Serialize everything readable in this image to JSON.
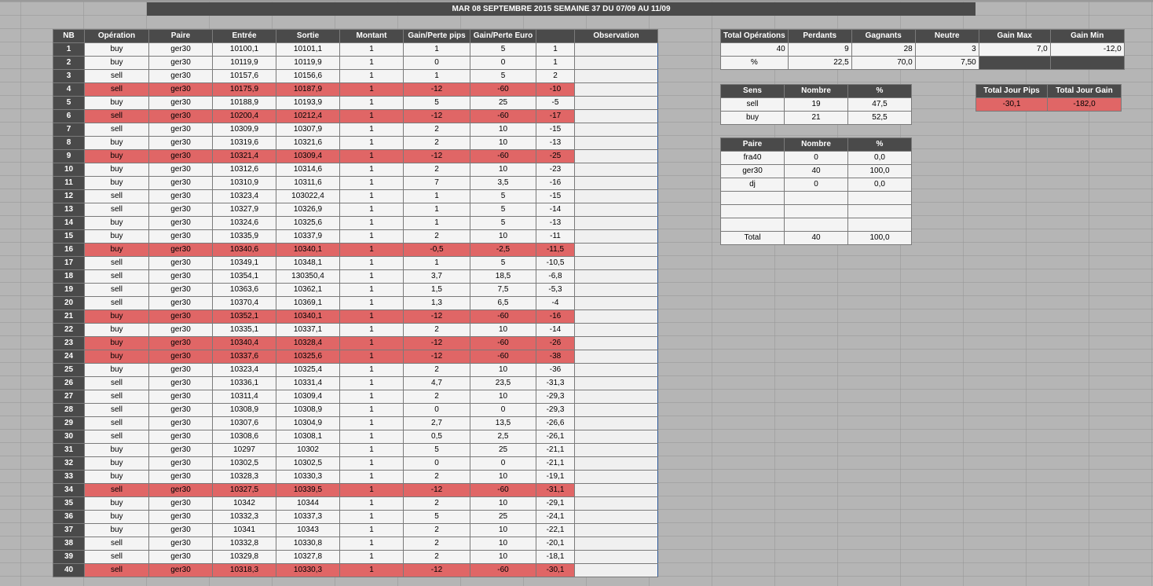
{
  "title": "MAR 08 SEPTEMBRE 2015 SEMAINE 37 DU 07/09 AU 11/09",
  "main_table": {
    "headers": [
      "NB",
      "Opération",
      "Paire",
      "Entrée",
      "Sortie",
      "Montant",
      "Gain/Perte pips",
      "Gain/Perte Euro",
      "",
      "Observation"
    ],
    "rows": [
      {
        "nb": "1",
        "op": "buy",
        "pair": "ger30",
        "in": "10100,1",
        "out": "10101,1",
        "amt": "1",
        "pips": "1",
        "eur": "5",
        "cum": "1",
        "loss": false
      },
      {
        "nb": "2",
        "op": "buy",
        "pair": "ger30",
        "in": "10119,9",
        "out": "10119,9",
        "amt": "1",
        "pips": "0",
        "eur": "0",
        "cum": "1",
        "loss": false
      },
      {
        "nb": "3",
        "op": "sell",
        "pair": "ger30",
        "in": "10157,6",
        "out": "10156,6",
        "amt": "1",
        "pips": "1",
        "eur": "5",
        "cum": "2",
        "loss": false
      },
      {
        "nb": "4",
        "op": "sell",
        "pair": "ger30",
        "in": "10175,9",
        "out": "10187,9",
        "amt": "1",
        "pips": "-12",
        "eur": "-60",
        "cum": "-10",
        "loss": true
      },
      {
        "nb": "5",
        "op": "buy",
        "pair": "ger30",
        "in": "10188,9",
        "out": "10193,9",
        "amt": "1",
        "pips": "5",
        "eur": "25",
        "cum": "-5",
        "loss": false
      },
      {
        "nb": "6",
        "op": "sell",
        "pair": "ger30",
        "in": "10200,4",
        "out": "10212,4",
        "amt": "1",
        "pips": "-12",
        "eur": "-60",
        "cum": "-17",
        "loss": true
      },
      {
        "nb": "7",
        "op": "sell",
        "pair": "ger30",
        "in": "10309,9",
        "out": "10307,9",
        "amt": "1",
        "pips": "2",
        "eur": "10",
        "cum": "-15",
        "loss": false
      },
      {
        "nb": "8",
        "op": "buy",
        "pair": "ger30",
        "in": "10319,6",
        "out": "10321,6",
        "amt": "1",
        "pips": "2",
        "eur": "10",
        "cum": "-13",
        "loss": false
      },
      {
        "nb": "9",
        "op": "buy",
        "pair": "ger30",
        "in": "10321,4",
        "out": "10309,4",
        "amt": "1",
        "pips": "-12",
        "eur": "-60",
        "cum": "-25",
        "loss": true
      },
      {
        "nb": "10",
        "op": "buy",
        "pair": "ger30",
        "in": "10312,6",
        "out": "10314,6",
        "amt": "1",
        "pips": "2",
        "eur": "10",
        "cum": "-23",
        "loss": false
      },
      {
        "nb": "11",
        "op": "buy",
        "pair": "ger30",
        "in": "10310,9",
        "out": "10311,6",
        "amt": "1",
        "pips": "7",
        "eur": "3,5",
        "cum": "-16",
        "loss": false
      },
      {
        "nb": "12",
        "op": "sell",
        "pair": "ger30",
        "in": "10323,4",
        "out": "103022,4",
        "amt": "1",
        "pips": "1",
        "eur": "5",
        "cum": "-15",
        "loss": false
      },
      {
        "nb": "13",
        "op": "sell",
        "pair": "ger30",
        "in": "10327,9",
        "out": "10326,9",
        "amt": "1",
        "pips": "1",
        "eur": "5",
        "cum": "-14",
        "loss": false
      },
      {
        "nb": "14",
        "op": "buy",
        "pair": "ger30",
        "in": "10324,6",
        "out": "10325,6",
        "amt": "1",
        "pips": "1",
        "eur": "5",
        "cum": "-13",
        "loss": false
      },
      {
        "nb": "15",
        "op": "buy",
        "pair": "ger30",
        "in": "10335,9",
        "out": "10337,9",
        "amt": "1",
        "pips": "2",
        "eur": "10",
        "cum": "-11",
        "loss": false
      },
      {
        "nb": "16",
        "op": "buy",
        "pair": "ger30",
        "in": "10340,6",
        "out": "10340,1",
        "amt": "1",
        "pips": "-0,5",
        "eur": "-2,5",
        "cum": "-11,5",
        "loss": true
      },
      {
        "nb": "17",
        "op": "sell",
        "pair": "ger30",
        "in": "10349,1",
        "out": "10348,1",
        "amt": "1",
        "pips": "1",
        "eur": "5",
        "cum": "-10,5",
        "loss": false
      },
      {
        "nb": "18",
        "op": "sell",
        "pair": "ger30",
        "in": "10354,1",
        "out": "130350,4",
        "amt": "1",
        "pips": "3,7",
        "eur": "18,5",
        "cum": "-6,8",
        "loss": false
      },
      {
        "nb": "19",
        "op": "sell",
        "pair": "ger30",
        "in": "10363,6",
        "out": "10362,1",
        "amt": "1",
        "pips": "1,5",
        "eur": "7,5",
        "cum": "-5,3",
        "loss": false
      },
      {
        "nb": "20",
        "op": "sell",
        "pair": "ger30",
        "in": "10370,4",
        "out": "10369,1",
        "amt": "1",
        "pips": "1,3",
        "eur": "6,5",
        "cum": "-4",
        "loss": false
      },
      {
        "nb": "21",
        "op": "buy",
        "pair": "ger30",
        "in": "10352,1",
        "out": "10340,1",
        "amt": "1",
        "pips": "-12",
        "eur": "-60",
        "cum": "-16",
        "loss": true
      },
      {
        "nb": "22",
        "op": "buy",
        "pair": "ger30",
        "in": "10335,1",
        "out": "10337,1",
        "amt": "1",
        "pips": "2",
        "eur": "10",
        "cum": "-14",
        "loss": false
      },
      {
        "nb": "23",
        "op": "buy",
        "pair": "ger30",
        "in": "10340,4",
        "out": "10328,4",
        "amt": "1",
        "pips": "-12",
        "eur": "-60",
        "cum": "-26",
        "loss": true
      },
      {
        "nb": "24",
        "op": "buy",
        "pair": "ger30",
        "in": "10337,6",
        "out": "10325,6",
        "amt": "1",
        "pips": "-12",
        "eur": "-60",
        "cum": "-38",
        "loss": true
      },
      {
        "nb": "25",
        "op": "buy",
        "pair": "ger30",
        "in": "10323,4",
        "out": "10325,4",
        "amt": "1",
        "pips": "2",
        "eur": "10",
        "cum": "-36",
        "loss": false
      },
      {
        "nb": "26",
        "op": "sell",
        "pair": "ger30",
        "in": "10336,1",
        "out": "10331,4",
        "amt": "1",
        "pips": "4,7",
        "eur": "23,5",
        "cum": "-31,3",
        "loss": false
      },
      {
        "nb": "27",
        "op": "sell",
        "pair": "ger30",
        "in": "10311,4",
        "out": "10309,4",
        "amt": "1",
        "pips": "2",
        "eur": "10",
        "cum": "-29,3",
        "loss": false
      },
      {
        "nb": "28",
        "op": "sell",
        "pair": "ger30",
        "in": "10308,9",
        "out": "10308,9",
        "amt": "1",
        "pips": "0",
        "eur": "0",
        "cum": "-29,3",
        "loss": false
      },
      {
        "nb": "29",
        "op": "sell",
        "pair": "ger30",
        "in": "10307,6",
        "out": "10304,9",
        "amt": "1",
        "pips": "2,7",
        "eur": "13,5",
        "cum": "-26,6",
        "loss": false
      },
      {
        "nb": "30",
        "op": "sell",
        "pair": "ger30",
        "in": "10308,6",
        "out": "10308,1",
        "amt": "1",
        "pips": "0,5",
        "eur": "2,5",
        "cum": "-26,1",
        "loss": false
      },
      {
        "nb": "31",
        "op": "buy",
        "pair": "ger30",
        "in": "10297",
        "out": "10302",
        "amt": "1",
        "pips": "5",
        "eur": "25",
        "cum": "-21,1",
        "loss": false
      },
      {
        "nb": "32",
        "op": "buy",
        "pair": "ger30",
        "in": "10302,5",
        "out": "10302,5",
        "amt": "1",
        "pips": "0",
        "eur": "0",
        "cum": "-21,1",
        "loss": false
      },
      {
        "nb": "33",
        "op": "buy",
        "pair": "ger30",
        "in": "10328,3",
        "out": "10330,3",
        "amt": "1",
        "pips": "2",
        "eur": "10",
        "cum": "-19,1",
        "loss": false
      },
      {
        "nb": "34",
        "op": "sell",
        "pair": "ger30",
        "in": "10327,5",
        "out": "10339,5",
        "amt": "1",
        "pips": "-12",
        "eur": "-60",
        "cum": "-31,1",
        "loss": true
      },
      {
        "nb": "35",
        "op": "buy",
        "pair": "ger30",
        "in": "10342",
        "out": "10344",
        "amt": "1",
        "pips": "2",
        "eur": "10",
        "cum": "-29,1",
        "loss": false
      },
      {
        "nb": "36",
        "op": "buy",
        "pair": "ger30",
        "in": "10332,3",
        "out": "10337,3",
        "amt": "1",
        "pips": "5",
        "eur": "25",
        "cum": "-24,1",
        "loss": false
      },
      {
        "nb": "37",
        "op": "buy",
        "pair": "ger30",
        "in": "10341",
        "out": "10343",
        "amt": "1",
        "pips": "2",
        "eur": "10",
        "cum": "-22,1",
        "loss": false
      },
      {
        "nb": "38",
        "op": "sell",
        "pair": "ger30",
        "in": "10332,8",
        "out": "10330,8",
        "amt": "1",
        "pips": "2",
        "eur": "10",
        "cum": "-20,1",
        "loss": false
      },
      {
        "nb": "39",
        "op": "sell",
        "pair": "ger30",
        "in": "10329,8",
        "out": "10327,8",
        "amt": "1",
        "pips": "2",
        "eur": "10",
        "cum": "-18,1",
        "loss": false
      },
      {
        "nb": "40",
        "op": "sell",
        "pair": "ger30",
        "in": "10318,3",
        "out": "10330,3",
        "amt": "1",
        "pips": "-12",
        "eur": "-60",
        "cum": "-30,1",
        "loss": true
      }
    ]
  },
  "summary": {
    "headers": [
      "Total Opérations",
      "Perdants",
      "Gagnants",
      "Neutre",
      "Gain Max",
      "Gain Min"
    ],
    "counts": [
      "40",
      "9",
      "28",
      "3",
      "7,0",
      "-12,0"
    ],
    "pct_label": "%",
    "pct": [
      "22,5",
      "70,0",
      "7,50"
    ]
  },
  "sens": {
    "headers": [
      "Sens",
      "Nombre",
      "%"
    ],
    "rows": [
      [
        "sell",
        "19",
        "47,5"
      ],
      [
        "buy",
        "21",
        "52,5"
      ]
    ]
  },
  "totals": {
    "headers": [
      "Total Jour Pips",
      "Total Jour Gain"
    ],
    "values": [
      "-30,1",
      "-182,0"
    ]
  },
  "paire": {
    "headers": [
      "Paire",
      "Nombre",
      "%"
    ],
    "rows": [
      [
        "fra40",
        "0",
        "0,0"
      ],
      [
        "ger30",
        "40",
        "100,0"
      ],
      [
        "dj",
        "0",
        "0,0"
      ]
    ],
    "total": [
      "Total",
      "40",
      "100,0"
    ]
  }
}
